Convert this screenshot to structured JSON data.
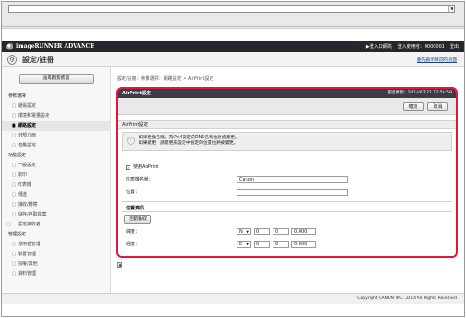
{
  "browser": {
    "address_value": "",
    "dropdown_glyph": "▼"
  },
  "header": {
    "app_name": "imageRUNNER ADVANCE",
    "logout_label": "▶登入口網站",
    "user_label": "登入使用者：0000001",
    "logout": "登出"
  },
  "title_bar": {
    "page_title": "設定/註冊",
    "link_label": "優先顯示目前的頁面"
  },
  "sidebar": {
    "remote_button": "遠端啟動裝置",
    "sections": [
      {
        "label": "參數選擇",
        "items": [
          "紙張設定",
          "環境和電量設定",
          "網路設定",
          "外部介面",
          "音量設定"
        ],
        "active_index": 2
      },
      {
        "label": "功能設定",
        "items": [
          "一般設定",
          "影印",
          "印表機",
          "傳送",
          "接收/轉寄",
          "儲存/存取檔案"
        ]
      }
    ],
    "standalone": "設定接收者",
    "management": {
      "label": "管理設定",
      "items": [
        "使用者管理",
        "裝置管理",
        "授權/其他",
        "資料管理"
      ]
    }
  },
  "breadcrumb": "設定/註冊：參數選擇：網路設定 > AirPrint設定",
  "panel": {
    "title": "AirPrint設定",
    "updated": "最近更新：2014/07/21 17:59:59",
    "ok_label": "確定",
    "cancel_label": "取消",
    "section_label": "AirPrint設定",
    "info_line1": "如果更換名稱，為IPv4設定的DNS名稱也將被變更。",
    "info_line2": "如果變更，請變更該設定中指定的位置也將被變更。",
    "use_airprint_label": "使用AirPrint",
    "use_airprint_checked": true,
    "printer_name_label": "印表機名稱：",
    "printer_name_value": "Canon",
    "location_label": "位置：",
    "location_value": "",
    "position_heading": "位置資訊",
    "auto_get_label": "自動獲取",
    "latitude_label": "緯度：",
    "latitude": {
      "dir": "N",
      "deg": "0",
      "min": "0",
      "sec": "0.000"
    },
    "longitude_label": "經度：",
    "longitude": {
      "dir": "E",
      "deg": "0",
      "min": "0",
      "sec": "0.000"
    }
  },
  "back_to_top_glyph": "▲",
  "footer": {
    "copyright": "Copyright CANON INC. 2014 All Rights Reserved"
  },
  "colors": {
    "highlight_border": "#e0193a",
    "header_bg": "#26262c",
    "panel_head_bg": "#3c3c48"
  }
}
